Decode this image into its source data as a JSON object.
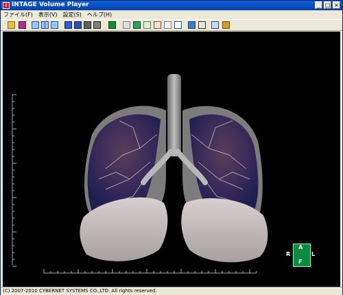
{
  "window": {
    "title": "INTAGE Volume Player",
    "app_icon": "i"
  },
  "window_buttons": {
    "minimize": "_",
    "maximize": "□",
    "close": "×"
  },
  "menu": [
    "ファイル(F)",
    "表示(V)",
    "設定(S)",
    "ヘルプ(H)"
  ],
  "toolbar": {
    "icons": [
      "open-folder-icon",
      "save-icon",
      "single-view-icon",
      "dual-view-icon",
      "quad-view-icon",
      "cube-blue-icon",
      "cube-blue2-icon",
      "cube-gray-icon",
      "cube-gray2-icon",
      "green-square-icon",
      "mip-icon",
      "cube-green-icon",
      "cube-wire-icon",
      "axes-icon",
      "label-icon",
      "blank-view-icon",
      "cylinder-icon",
      "person-icon",
      "slice-icon",
      "grid-icon"
    ]
  },
  "orientation": {
    "top": "A",
    "bottom": "F",
    "left": "R",
    "right": "L"
  },
  "status": {
    "copyright": "(C) 2007-2010 CYBERNET SYSTEMS CO.,LTD. All rights reserved."
  },
  "colors": {
    "title_bar": "#0a5fd8",
    "viewport_bg": "#000000",
    "orientation_box": "#0c8a3e"
  }
}
